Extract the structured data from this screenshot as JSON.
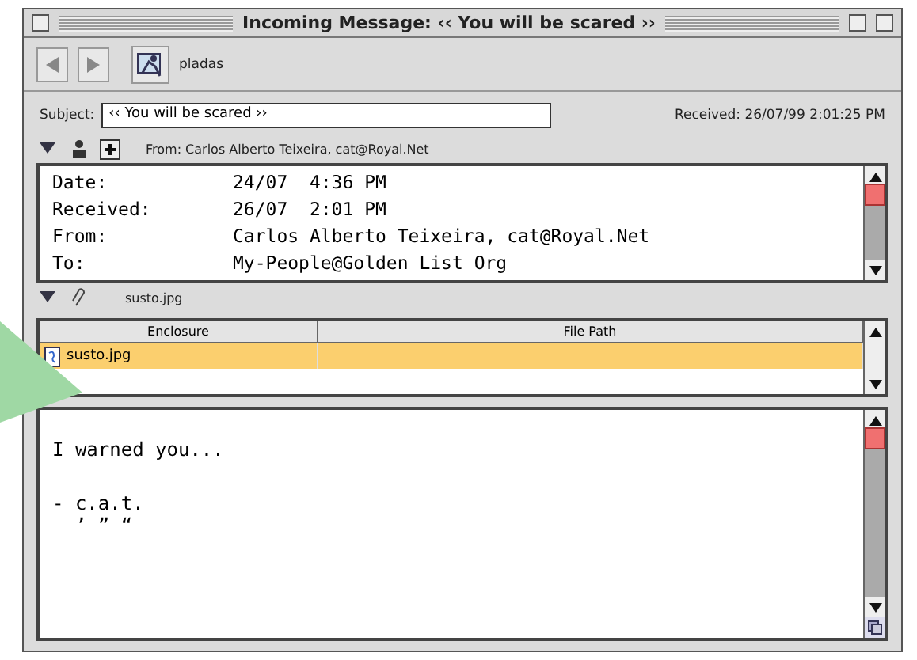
{
  "window": {
    "title": "Incoming Message: ‹‹ You will be scared ››"
  },
  "toolbar": {
    "mailbox": "pladas"
  },
  "subject": {
    "label": "Subject:",
    "value": "‹‹ You will be scared ››",
    "received": "Received: 26/07/99 2:01:25 PM"
  },
  "from_line": {
    "expanded": true,
    "text": "From: Carlos Alberto Teixeira, cat@Royal.Net"
  },
  "headers": [
    {
      "name": "Date:",
      "value": "24/07  4:36 PM"
    },
    {
      "name": "Received:",
      "value": "26/07  2:01 PM"
    },
    {
      "name": "From:",
      "value": "Carlos Alberto Teixeira, cat@Royal.Net"
    },
    {
      "name": "To:",
      "value": "My-People@Golden List Org"
    }
  ],
  "attachments_line": {
    "expanded": true,
    "text": "susto.jpg"
  },
  "table": {
    "columns": [
      "Enclosure",
      "File Path"
    ],
    "rows": [
      {
        "enclosure": "susto.jpg",
        "selected": true
      }
    ]
  },
  "body": {
    "paragraphs": [
      [
        "I warned you..."
      ],
      [
        "- c.a.t.",
        "  ’ ” “"
      ]
    ]
  }
}
